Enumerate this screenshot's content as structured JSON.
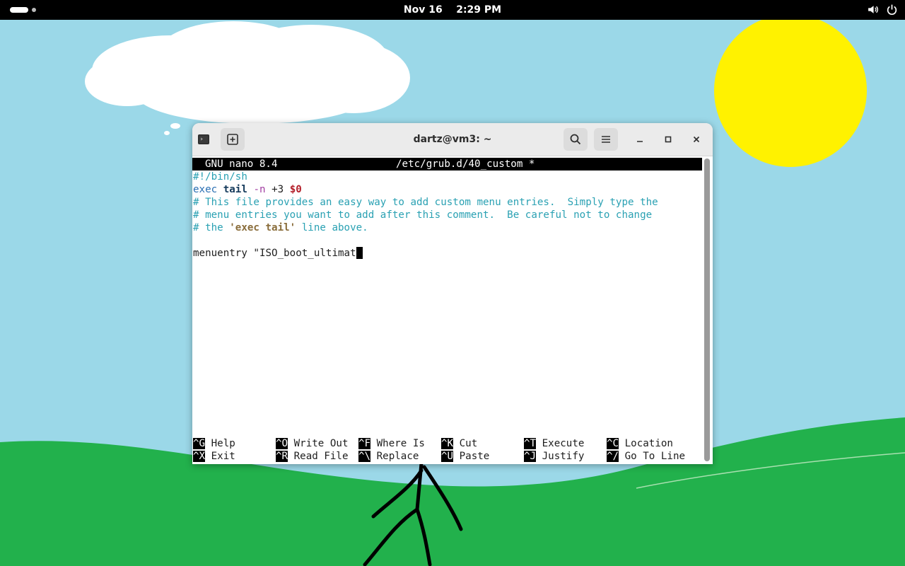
{
  "topbar": {
    "date": "Nov 16",
    "time": "2:29 PM",
    "icons": [
      "volume-icon",
      "power-icon"
    ]
  },
  "window": {
    "title": "dartz@vm3: ~",
    "buttons": [
      "terminal-icon",
      "new-tab-icon",
      "search-icon",
      "menu-icon",
      "minimize-icon",
      "maximize-icon",
      "close-icon"
    ]
  },
  "nano": {
    "version": "GNU nano 8.4",
    "filename": "/etc/grub.d/40_custom *",
    "lines": {
      "l1": "#!/bin/sh",
      "l2_exec": "exec ",
      "l2_tail": "tail",
      "l2_n": "-n",
      "l2_plus": " +3 ",
      "l2_var": "$0",
      "l3": "# This file provides an easy way to add custom menu entries.  Simply type the",
      "l4": "# menu entries you want to add after this comment.  Be careful not to change",
      "l5_a": "# the ",
      "l5_b": "'exec tail'",
      "l5_c": " line above.",
      "l7": "menuentry \"ISO_boot_ultimat"
    },
    "shortcuts": [
      {
        "key": "^G",
        "label": "Help"
      },
      {
        "key": "^O",
        "label": "Write Out"
      },
      {
        "key": "^F",
        "label": "Where Is"
      },
      {
        "key": "^K",
        "label": "Cut"
      },
      {
        "key": "^T",
        "label": "Execute"
      },
      {
        "key": "^C",
        "label": "Location"
      },
      {
        "key": "^X",
        "label": "Exit"
      },
      {
        "key": "^R",
        "label": "Read File"
      },
      {
        "key": "^\\",
        "label": "Replace"
      },
      {
        "key": "^U",
        "label": "Paste"
      },
      {
        "key": "^J",
        "label": "Justify"
      },
      {
        "key": "^/",
        "label": "Go To Line"
      }
    ]
  },
  "colors": {
    "sky": "#9bd8e8",
    "grass": "#22b14c",
    "sun": "#fff200",
    "comment": "#2aa1b3"
  }
}
